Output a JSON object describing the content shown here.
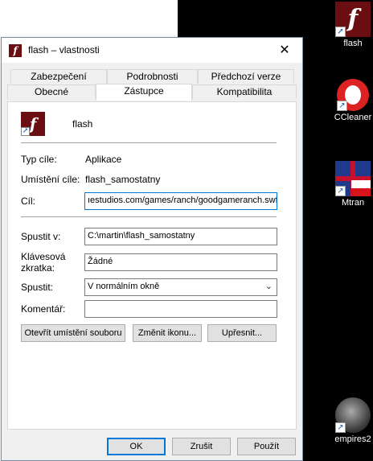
{
  "window": {
    "title": "flash – vlastnosti",
    "close_glyph": "✕"
  },
  "tabs": {
    "row1": [
      "Zabezpečení",
      "Podrobnosti",
      "Předchozí verze"
    ],
    "row2": [
      "Obecné",
      "Zástupce",
      "Kompatibilita"
    ],
    "active": "Zástupce"
  },
  "shortcut": {
    "name": "flash",
    "target_type_label": "Typ cíle:",
    "target_type_value": "Aplikace",
    "target_location_label": "Umístění cíle:",
    "target_location_value": "flash_samostatny",
    "target_label": "Cíl:",
    "target_value": "ıestudios.com/games/ranch/goodgameranch.swf",
    "start_in_label": "Spustit v:",
    "start_in_value": "C:\\martin\\flash_samostatny",
    "hotkey_label_line1": "Klávesová",
    "hotkey_label_line2": "zkratka:",
    "hotkey_value": "Žádné",
    "run_label": "Spustit:",
    "run_value": "V normálním okně",
    "comment_label": "Komentář:",
    "comment_value": ""
  },
  "buttons": {
    "open_location": "Otevřít umístění souboru",
    "change_icon": "Změnit ikonu...",
    "advanced": "Upřesnit...",
    "ok": "OK",
    "cancel": "Zrušit",
    "apply": "Použít"
  },
  "desktop": {
    "icons": [
      {
        "label": "flash",
        "icon": "flash-icon"
      },
      {
        "label": "CCleaner",
        "icon": "ccleaner-icon"
      },
      {
        "label": "Mtran",
        "icon": "flag-icon"
      },
      {
        "label": "empires2",
        "icon": "knight-icon"
      }
    ]
  }
}
